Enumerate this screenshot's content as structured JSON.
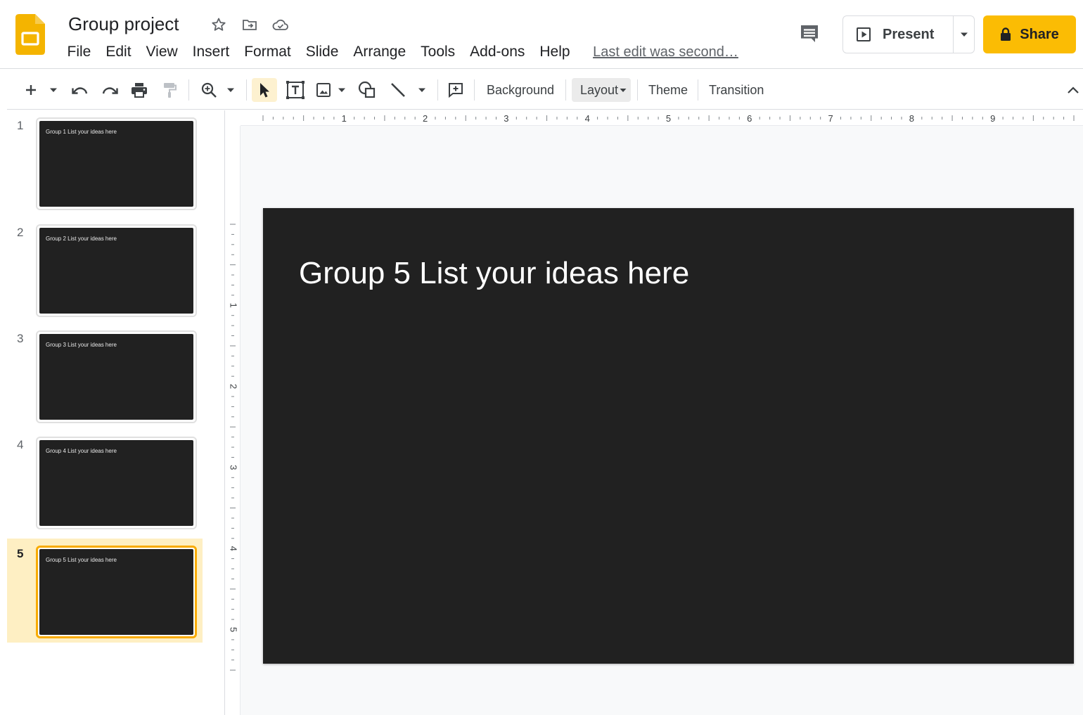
{
  "app": {
    "icon": "slides-logo",
    "document_title": "Group project",
    "brand_color": "#fbbc04"
  },
  "title_icons": [
    "star-icon",
    "move-to-folder-icon",
    "cloud-saved-icon"
  ],
  "menu": {
    "items": [
      "File",
      "Edit",
      "View",
      "Insert",
      "Format",
      "Slide",
      "Arrange",
      "Tools",
      "Add-ons",
      "Help"
    ],
    "last_edit": "Last edit was second…"
  },
  "actions": {
    "comments_icon": "comments-icon",
    "present_label": "Present",
    "share_label": "Share"
  },
  "toolbar": {
    "icons": [
      "add-icon",
      "dropdown-icon",
      "undo-icon",
      "redo-icon",
      "print-icon",
      "paint-format-icon",
      "zoom-icon",
      "select-icon",
      "text-box-icon",
      "image-icon",
      "shape-icon",
      "line-icon",
      "comment-add-icon",
      "collapse-icon"
    ],
    "background_label": "Background",
    "layout_label": "Layout",
    "theme_label": "Theme",
    "transition_label": "Transition"
  },
  "slides": [
    {
      "number": "1",
      "text": "Group 1 List your ideas here"
    },
    {
      "number": "2",
      "text": "Group 2 List your ideas here"
    },
    {
      "number": "3",
      "text": "Group 3 List your ideas here"
    },
    {
      "number": "4",
      "text": "Group 4 List your ideas here"
    },
    {
      "number": "5",
      "text": "Group 5 List your ideas here"
    }
  ],
  "selected_slide": "5",
  "canvas": {
    "slide_title": "Group 5 List your ideas here",
    "slide_background": "#212121",
    "ruler_top_labels": [
      "1",
      "2",
      "3",
      "4",
      "5",
      "6",
      "7",
      "8",
      "9"
    ],
    "ruler_left_labels": [
      "1",
      "2",
      "3",
      "4",
      "5"
    ]
  }
}
